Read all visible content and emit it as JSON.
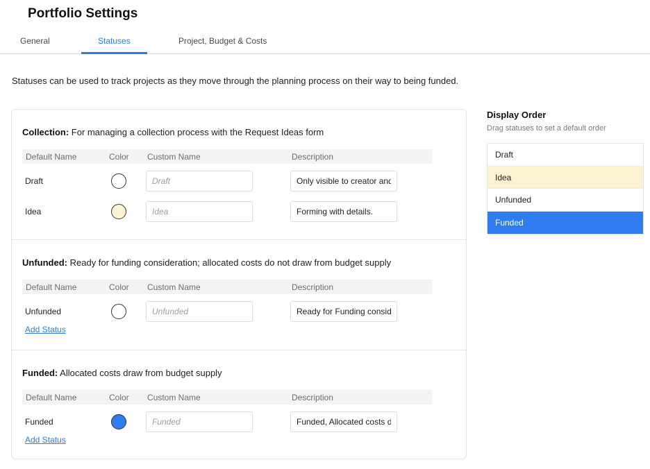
{
  "page": {
    "title": "Portfolio Settings"
  },
  "tabs": [
    {
      "label": "General",
      "active": false
    },
    {
      "label": "Statuses",
      "active": true
    },
    {
      "label": "Project, Budget & Costs",
      "active": false
    }
  ],
  "intro": "Statuses can be used to track projects as they move through the planning process on their way to being funded.",
  "table_headers": {
    "default_name": "Default Name",
    "color": "Color",
    "custom_name": "Custom Name",
    "description": "Description"
  },
  "sections": {
    "collection": {
      "title": "Collection:",
      "subtitle": "For managing a collection process with the Request Ideas form",
      "rows": [
        {
          "default_name": "Draft",
          "color": "#ffffff",
          "custom_placeholder": "Draft",
          "description": "Only visible to creator and"
        },
        {
          "default_name": "Idea",
          "color": "#fdf3d2",
          "custom_placeholder": "Idea",
          "description": "Forming with details."
        }
      ]
    },
    "unfunded": {
      "title": "Unfunded:",
      "subtitle": "Ready for funding consideration; allocated costs do not draw from budget supply",
      "rows": [
        {
          "default_name": "Unfunded",
          "color": "#ffffff",
          "custom_placeholder": "Unfunded",
          "description": "Ready for Funding consideration"
        }
      ],
      "add_label": "Add Status"
    },
    "funded": {
      "title": "Funded:",
      "subtitle": "Allocated costs draw from budget supply",
      "rows": [
        {
          "default_name": "Funded",
          "color": "#2f7cf0",
          "custom_placeholder": "Funded",
          "description": "Funded, Allocated costs draw"
        }
      ],
      "add_label": "Add Status"
    }
  },
  "display_order": {
    "title": "Display Order",
    "subtitle": "Drag statuses to set a default order",
    "items": [
      {
        "label": "Draft",
        "bg": "#ffffff",
        "fg": "#222222"
      },
      {
        "label": "Idea",
        "bg": "#fdf3d2",
        "fg": "#222222"
      },
      {
        "label": "Unfunded",
        "bg": "#ffffff",
        "fg": "#222222"
      },
      {
        "label": "Funded",
        "bg": "#2f7cf0",
        "fg": "#ffffff"
      }
    ]
  },
  "colors": {
    "accent": "#2a7de1"
  }
}
